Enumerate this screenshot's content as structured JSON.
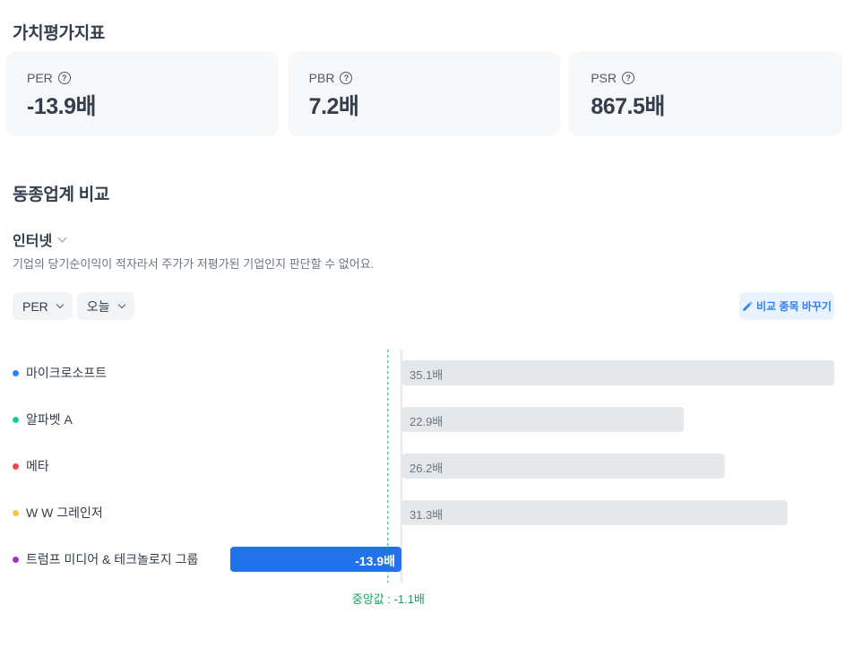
{
  "valuation": {
    "title": "가치평가지표",
    "help_icon": "question-circle-icon",
    "cards": [
      {
        "label": "PER",
        "value": "-13.9배"
      },
      {
        "label": "PBR",
        "value": "7.2배"
      },
      {
        "label": "PSR",
        "value": "867.5배"
      }
    ]
  },
  "peer": {
    "title": "동종업계 비교",
    "industry": "인터넷",
    "description": "기업의 당기순이익이 적자라서 주가가 저평가된 기업인지 판단할 수 없어요.",
    "metric_chip": "PER",
    "period_chip": "오늘",
    "compare_button": "비교 종목 바꾸기",
    "pencil_icon": "pencil-icon"
  },
  "chart_data": {
    "type": "bar",
    "orientation": "horizontal",
    "categories": [
      "마이크로소프트",
      "알파벳 A",
      "메타",
      "W W 그레인저",
      "트럼프 미디어 & 테크놀로지 그룹"
    ],
    "values": [
      35.1,
      22.9,
      26.2,
      31.3,
      -13.9
    ],
    "value_labels": [
      "35.1배",
      "22.9배",
      "26.2배",
      "31.3배",
      "-13.9배"
    ],
    "dot_colors": [
      "#3182f6",
      "#20c997",
      "#f04452",
      "#ffc342",
      "#a234c7"
    ],
    "bar_color": "#e5e8eb",
    "highlight_color": "#2272eb",
    "highlight_index": 4,
    "median": -1.1,
    "median_label": "중앙값 : -1.1배",
    "median_color": "#15a35c",
    "xlim": [
      -13.9,
      35.1
    ]
  }
}
